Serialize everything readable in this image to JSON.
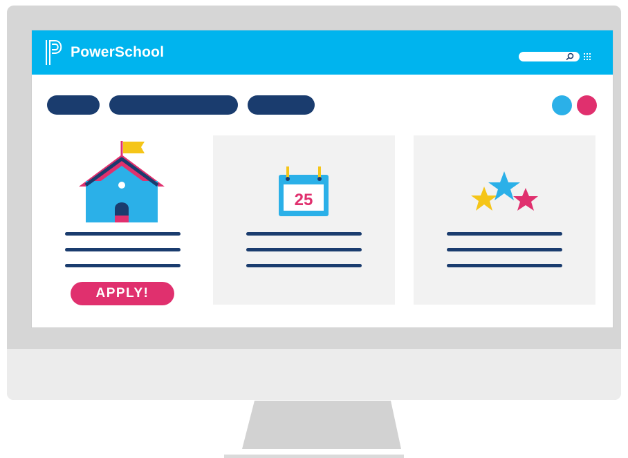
{
  "header": {
    "brand_name": "PowerSchool",
    "brand_color": "#00b4ee",
    "logo_icon": "powerschool-logo-icon",
    "search_icon": "search-icon",
    "apps_icon": "grid-icon"
  },
  "nav": {
    "pill_color": "#1a3c6e",
    "indicator_colors": [
      "#2bb0e8",
      "#e0306e"
    ]
  },
  "cards": [
    {
      "icon": "schoolhouse-icon",
      "apply_label": "APPLY!"
    },
    {
      "icon": "calendar-icon",
      "calendar_day": "25"
    },
    {
      "icon": "stars-icon"
    }
  ],
  "colors": {
    "accent_pink": "#e0306e",
    "accent_blue": "#2bb0e8",
    "accent_yellow": "#f5c518",
    "navy": "#1a3c6e"
  }
}
